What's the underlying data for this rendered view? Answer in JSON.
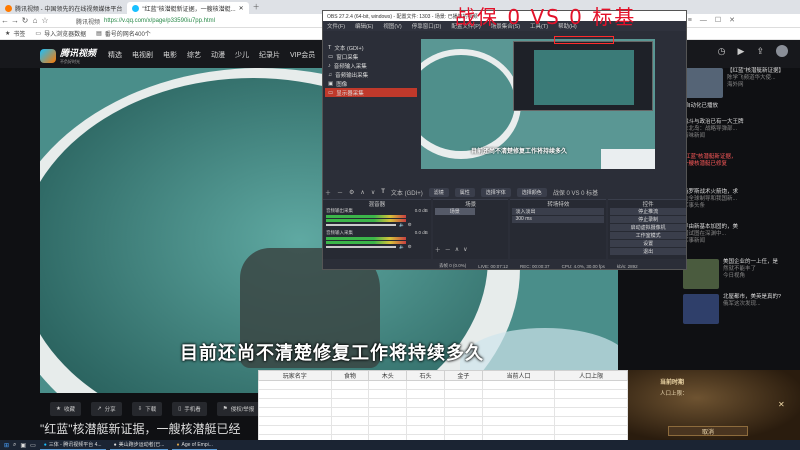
{
  "browser": {
    "tabs": [
      {
        "label": "腾讯视频 - 中国领先的在线视频媒体平台"
      },
      {
        "label": "\"红蓝\"核潜艇新证据，一艘核潜艇..."
      }
    ],
    "url": "https://v.qq.com/x/page/p33590iu7pp.html",
    "url_prefix": "腾讯视频",
    "bookmarks": [
      {
        "label": "书签"
      },
      {
        "label": "导入浏览器数据"
      },
      {
        "label": "番号的网名400个"
      }
    ]
  },
  "site": {
    "logo_text": "腾讯视频",
    "logo_sub": "不负好时光",
    "nav": [
      "精选",
      "电视剧",
      "电影",
      "综艺",
      "动漫",
      "少儿",
      "纪录片",
      "VIP会员",
      "游戏",
      "日"
    ],
    "subtitle": "目前还尚不清楚修复工作将持续多久",
    "actions": [
      "收藏",
      "分享",
      "下载",
      "手机看",
      "侵权/举报"
    ],
    "below_title": "\"红蓝\"核潜艇新证据，一艘核潜艇已经"
  },
  "sidebar": {
    "items": [
      {
        "title": "【红蓝\"核潜艇新证据】",
        "sub": "陈学飞频道华大使...",
        "tag": "海外网"
      },
      {
        "title": "自动化已播放",
        "sub": "",
        "tag": ""
      },
      {
        "title": "战斗与政治已有一大王牌",
        "sub": "东北岛：战略导弹部...",
        "tag": "百味新闻"
      },
      {
        "title": "\"红蓝\"核潜艇新证据，",
        "sub": "一艘核潜艇已修复",
        "tag": "",
        "red": true
      },
      {
        "title": "俄罗斯战术火箭炮，求",
        "sub": "助全球制导和我国新...",
        "tag": "军事头条"
      },
      {
        "title": "洋由新基本加固的，美",
        "sub": "国试图在深渊中...",
        "tag": "军事新闻"
      },
      {
        "title": "美国企业的一上任，是",
        "sub": "然就不能丰了",
        "tag": "今日视角"
      },
      {
        "title": "北屋都市，美英是真的?",
        "sub": "俄军这次发现...",
        "tag": ""
      },
      {
        "title": "拜登急了，警告俄若敢",
        "sub": "使用核武器，就让俄...",
        "tag": ""
      }
    ]
  },
  "obs": {
    "title": "OBS 27.2.4 (64-bit, windows) - 配置文件: 1303 - 场景: 已播放的视频",
    "menu": [
      "文件(F)",
      "编辑(E)",
      "视图(V)",
      "停靠窗口(D)",
      "配置文件(P)",
      "场景集合(S)",
      "工具(T)",
      "帮助(H)"
    ],
    "sources": [
      {
        "label": "文本 (GDI+)",
        "selected": false
      },
      {
        "label": "窗口采集",
        "selected": false
      },
      {
        "label": "音频输入采集",
        "selected": false
      },
      {
        "label": "音频输出采集",
        "selected": false
      },
      {
        "label": "图像",
        "selected": false
      },
      {
        "label": "显示器采集",
        "selected": true
      }
    ],
    "toolbar_source": "文本 (GDI+)",
    "toolbar_buttons": [
      "滤镜",
      "过滤器",
      "属性",
      "源",
      "选择字体",
      "选择颜色"
    ],
    "toolbar_text": "战保 0 VS 0 标基",
    "docks": {
      "sources_title": "混音器",
      "scenes_title": "场景",
      "transitions_title": "转场特效",
      "controls_title": "控件",
      "mixer": [
        {
          "label": "音频输出采集",
          "db": "0.0 dB"
        },
        {
          "label": "音频输入采集",
          "db": "0.0 dB"
        }
      ],
      "scene_item": "场景",
      "transition_item": "淡入淡出",
      "transition_duration": "300 ms",
      "controls": [
        "停止推流",
        "停止录制",
        "启动虚拟摄像机",
        "工作室模式",
        "设置",
        "退出"
      ]
    },
    "status": [
      "丢帧 0 (0.0%)",
      "LIVE: 00:07:12",
      "REC: 00:00:37",
      "CPU: 4.0%, 30.00 fps",
      "kb/s: 2892"
    ],
    "preview_subtitle": "目前还尚不清楚修复工作将持续多久"
  },
  "overlay_title": "战保 0 VS 0 标基",
  "sheet": {
    "headers": [
      "玩家名字",
      "食物",
      "木头",
      "石头",
      "金子",
      "当前人口",
      "人口上限"
    ]
  },
  "game": {
    "title": "当前时期",
    "sub": "人口上限：",
    "button": "取消"
  },
  "taskbar": {
    "items": [
      "三体 - 腾讯视频平台 4...",
      "美山跑步运动者(已...",
      "Age of Empi..."
    ]
  }
}
